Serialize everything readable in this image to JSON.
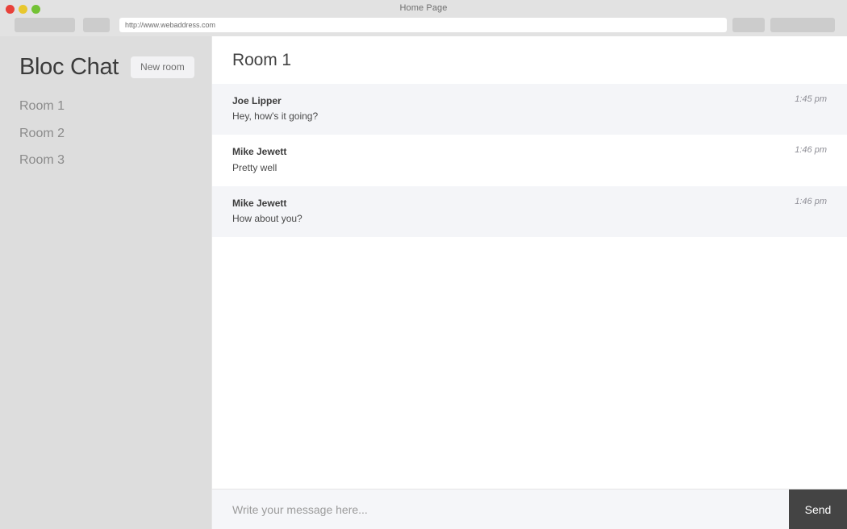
{
  "browser": {
    "window_title": "Home Page",
    "url": "http://www.webaddress.com",
    "traffic_lights": [
      "close-red",
      "minimize-yellow",
      "maximize-green"
    ],
    "toolbar_buttons": [
      "nav-buttons-placeholder",
      "reload-button-placeholder",
      "right-button-placeholder-a",
      "right-button-placeholder-b"
    ],
    "colors": {
      "chrome": "#e2e2e2",
      "red": "#e8413a",
      "yellow": "#e8c72d",
      "green": "#73c234"
    }
  },
  "sidebar": {
    "brand": "Bloc Chat",
    "new_room_label": "New room",
    "rooms": [
      {
        "label": "Room 1"
      },
      {
        "label": "Room 2"
      },
      {
        "label": "Room 3"
      }
    ],
    "colors": {
      "background": "#dddddd",
      "room_text": "#8b8b8b",
      "brand_text": "#3b3b3b"
    }
  },
  "main": {
    "room_title": "Room 1",
    "messages": [
      {
        "author": "Joe Lipper",
        "text": "Hey, how's it going?",
        "time": "1:45 pm"
      },
      {
        "author": "Mike Jewett",
        "text": "Pretty well",
        "time": "1:46 pm"
      },
      {
        "author": "Mike Jewett",
        "text": "How about you?",
        "time": "1:46 pm"
      }
    ],
    "composer": {
      "placeholder": "Write your message here...",
      "value": "",
      "send_label": "Send"
    },
    "colors": {
      "stripe": "#f4f5f8",
      "plain": "#ffffff",
      "send_button": "#444444",
      "composer_background": "#f5f6f9"
    }
  }
}
